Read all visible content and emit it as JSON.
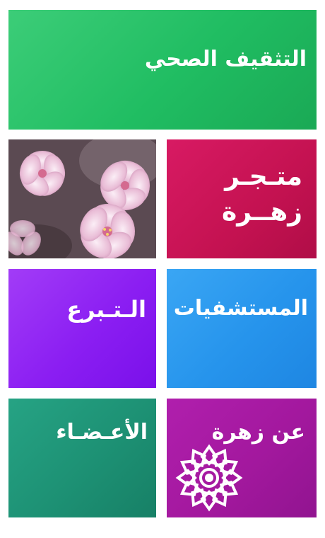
{
  "tiles": {
    "health_education": {
      "label": "التثقيف الصحي",
      "color": "#20bd62"
    },
    "photo": {
      "icon": "cherry-blossom-photo"
    },
    "store": {
      "label_line1": "متـجـر",
      "label_line2": "زهــرة",
      "color": "#c41251"
    },
    "donate": {
      "label": "الـتـبرع",
      "color": "#8b1ef2"
    },
    "hospitals": {
      "label": "المستشفيات",
      "color": "#2694ec"
    },
    "members": {
      "label": "الأعـضـاء",
      "color": "#1d9174"
    },
    "about": {
      "label": "عن زهرة",
      "color": "#a3189e",
      "icon": "zahra-flower-logo-icon"
    }
  }
}
